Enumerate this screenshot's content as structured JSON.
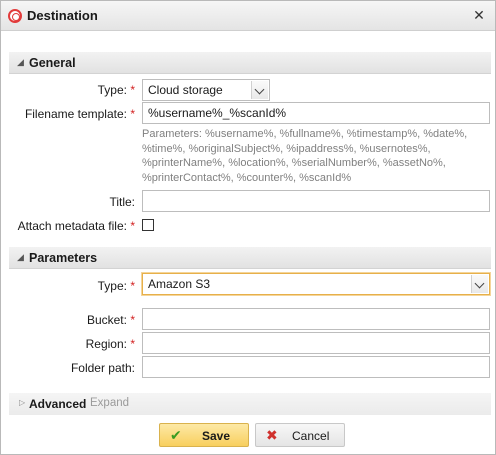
{
  "window": {
    "title": "Destination",
    "title_icon": "target-icon",
    "close_icon": "close-icon"
  },
  "general": {
    "section_label": "General",
    "type_label": "Type:",
    "type_value": "Cloud storage",
    "filename_label": "Filename template:",
    "filename_value": "%username%_%scanId%",
    "parameters_hint": "Parameters: %username%, %fullname%, %timestamp%, %date%, %time%, %originalSubject%, %ipaddress%, %usernotes%, %printerName%, %location%, %serialNumber%, %assetNo%, %printerContact%, %counter%, %scanId%",
    "title_label": "Title:",
    "title_value": "",
    "attach_metadata_label": "Attach metadata file:",
    "attach_metadata_checked": false
  },
  "parameters": {
    "section_label": "Parameters",
    "type_label": "Type:",
    "type_value": "Amazon S3",
    "bucket_label": "Bucket:",
    "bucket_value": "",
    "region_label": "Region:",
    "region_value": "",
    "folder_label": "Folder path:",
    "folder_value": ""
  },
  "advanced": {
    "label": "Advanced",
    "expand_label": "Expand"
  },
  "buttons": {
    "save_label": "Save",
    "cancel_label": "Cancel"
  },
  "required_marker": "*",
  "colors": {
    "required": "#d21f1f",
    "save_bg": "#f8cf5e",
    "focus": "#e7b04a"
  }
}
